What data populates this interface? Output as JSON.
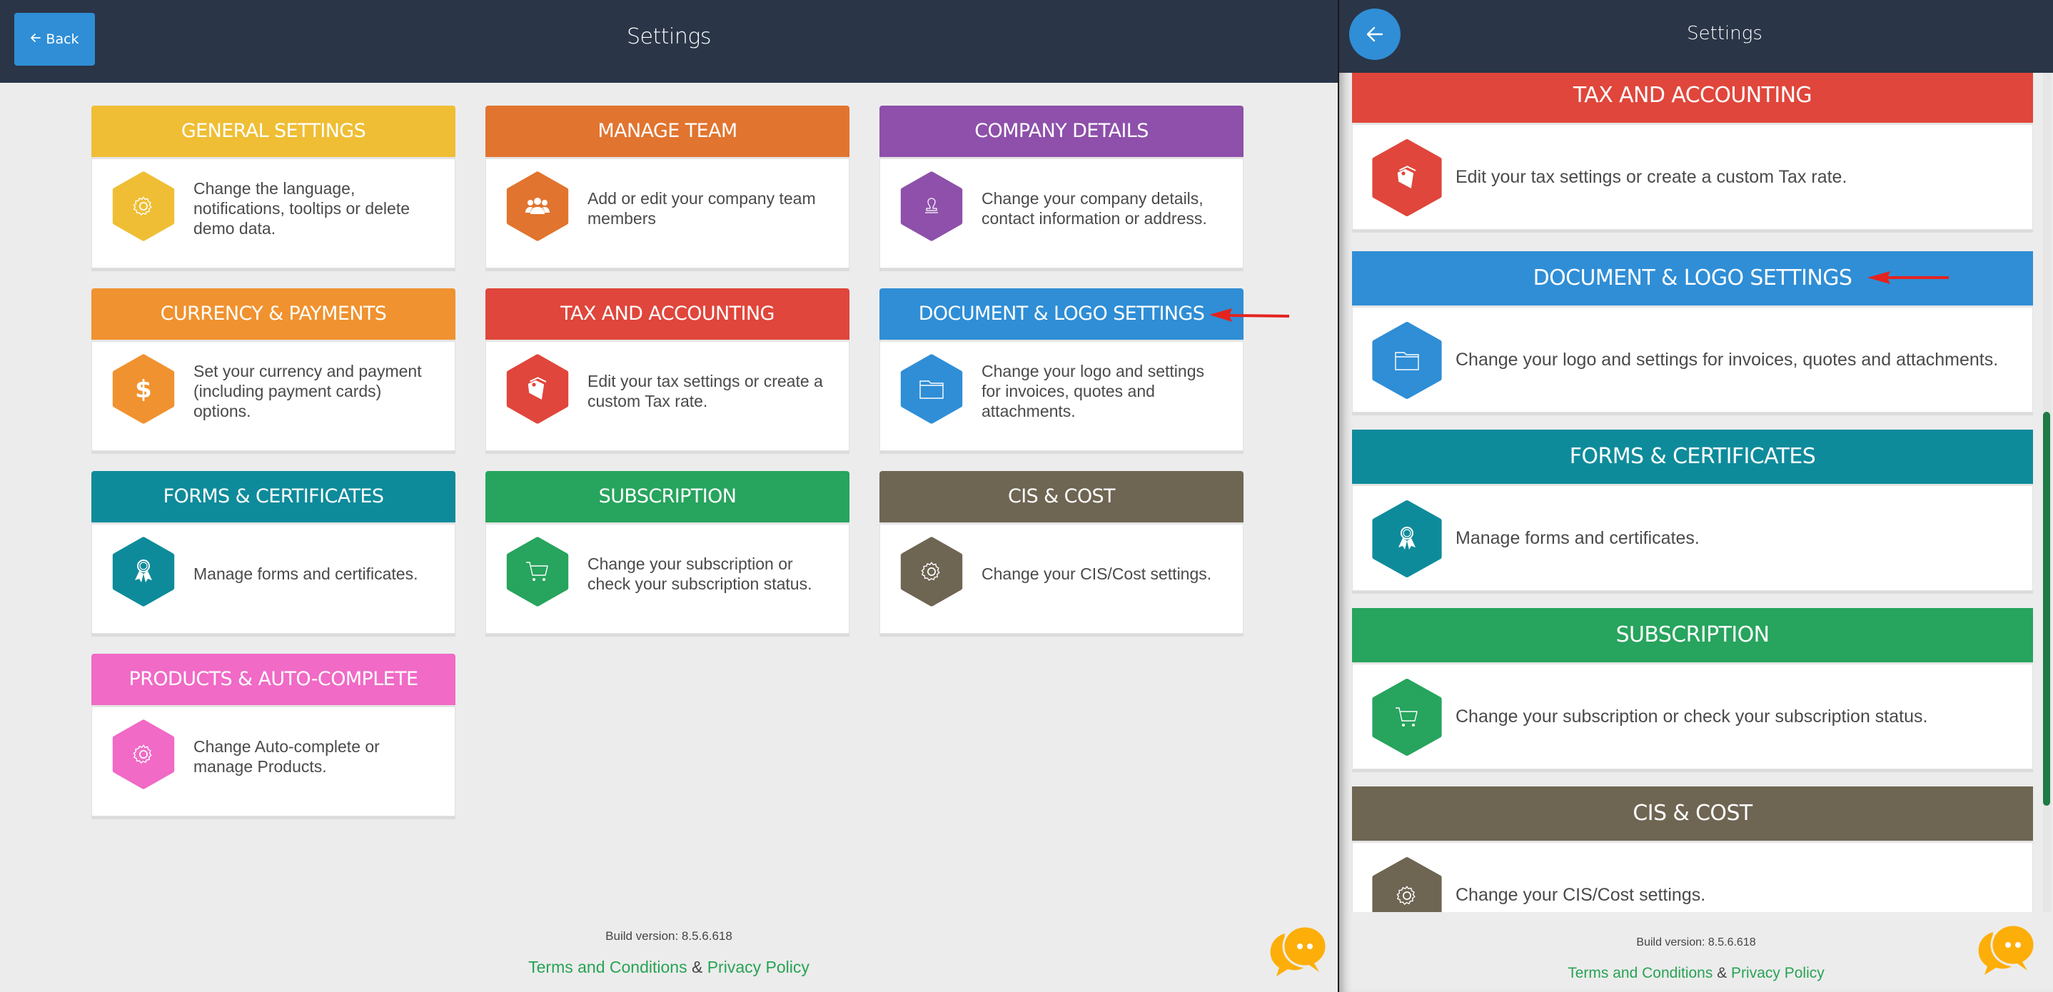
{
  "left": {
    "header": {
      "title": "Settings",
      "back_label": "Back",
      "back_icon": "arrow-left-icon"
    },
    "cards": [
      {
        "title": "GENERAL SETTINGS",
        "description": "Change the language, notifications, tooltips or delete demo data.",
        "color": "#EFBE34",
        "icon": "gear-icon"
      },
      {
        "title": "MANAGE TEAM",
        "description": "Add or edit your company team members",
        "color": "#E1742F",
        "icon": "team-icon"
      },
      {
        "title": "COMPANY DETAILS",
        "description": "Change your company details, contact information or address.",
        "color": "#8E50AA",
        "icon": "user-stamp-icon"
      },
      {
        "title": "CURRENCY & PAYMENTS",
        "description": "Set your currency and payment (including payment cards) options.",
        "color": "#F0922F",
        "icon": "dollar-icon"
      },
      {
        "title": "TAX AND ACCOUNTING",
        "description": "Edit your tax settings or create a custom Tax rate.",
        "color": "#E0463B",
        "icon": "tag-icon"
      },
      {
        "title": "DOCUMENT & LOGO SETTINGS",
        "description": "Change your logo and settings for invoices, quotes and attachments.",
        "color": "#2F8ED6",
        "icon": "folder-icon"
      },
      {
        "title": "FORMS & CERTIFICATES",
        "description": "Manage forms and certificates.",
        "color": "#0E8B9B",
        "icon": "award-icon"
      },
      {
        "title": "SUBSCRIPTION",
        "description": "Change your subscription or check your subscription status.",
        "color": "#27A45D",
        "icon": "cart-icon"
      },
      {
        "title": "CIS & COST",
        "description": "Change your CIS/Cost settings.",
        "color": "#6E6553",
        "icon": "gear-icon"
      },
      {
        "title": "PRODUCTS & AUTO-COMPLETE",
        "description": "Change Auto-complete or manage Products.",
        "color": "#F06AC6",
        "icon": "gear-icon"
      }
    ],
    "footer": {
      "build": "Build version: 8.5.6.618",
      "terms": "Terms and Conditions",
      "amp": " & ",
      "privacy": "Privacy Policy"
    }
  },
  "right": {
    "header": {
      "title": "Settings",
      "back_icon": "arrow-left-icon"
    },
    "cards": [
      {
        "title": "TAX AND ACCOUNTING",
        "description": "Edit your tax settings or create a custom Tax rate.",
        "color": "#E0463B",
        "icon": "tag-icon"
      },
      {
        "title": "DOCUMENT & LOGO SETTINGS",
        "description": "Change your logo and settings for invoices, quotes and attachments.",
        "color": "#2F8ED6",
        "icon": "folder-icon"
      },
      {
        "title": "FORMS & CERTIFICATES",
        "description": "Manage forms and certificates.",
        "color": "#0E8B9B",
        "icon": "award-icon"
      },
      {
        "title": "SUBSCRIPTION",
        "description": "Change your subscription or check your subscription status.",
        "color": "#27A45D",
        "icon": "cart-icon"
      },
      {
        "title": "CIS & COST",
        "description": "Change your CIS/Cost settings.",
        "color": "#6E6553",
        "icon": "gear-icon"
      }
    ],
    "footer": {
      "build": "Build version: 8.5.6.618",
      "terms": "Terms and Conditions",
      "amp": " & ",
      "privacy": "Privacy Policy"
    }
  },
  "colors": {
    "topbar": "#2A3547",
    "accent": "#2F8ED6",
    "link": "#27A354",
    "chat": "#FDAE08",
    "annotation_arrow": "#E4231F",
    "scroll_thumb": "#1F7A46"
  },
  "annotation": {
    "highlighted_card": "DOCUMENT & LOGO SETTINGS"
  }
}
